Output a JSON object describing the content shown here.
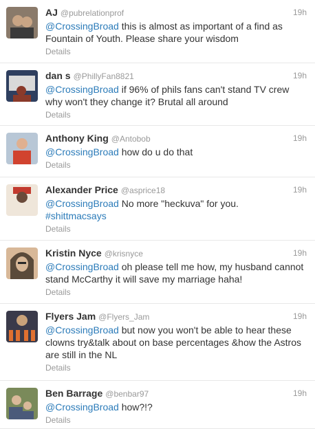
{
  "tweets": [
    {
      "name": "AJ",
      "handle": "@pubrelationprof",
      "time": "19h",
      "mention": "@CrossingBroad",
      "text": " this is almost as important of a find as Fountain of Youth. Please share your wisdom",
      "details": "Details",
      "avatar_colors": [
        "#8a7a6a",
        "#c9a585",
        "#3a3a3a"
      ]
    },
    {
      "name": "dan s",
      "handle": "@PhillyFan8821",
      "time": "19h",
      "mention": "@CrossingBroad",
      "text": " if 96% of phils fans can't stand TV crew why won't they change it?  Brutal all around",
      "details": "Details",
      "avatar_colors": [
        "#2f3f5f",
        "#d9d9d9",
        "#8a3a2a"
      ]
    },
    {
      "name": "Anthony King",
      "handle": "@Antobob",
      "time": "19h",
      "mention": "@CrossingBroad",
      "text": " how do u do that",
      "details": "Details",
      "avatar_colors": [
        "#b8c7d6",
        "#d1432f",
        "#e0b090"
      ]
    },
    {
      "name": "Alexander Price",
      "handle": "@asprice18",
      "time": "19h",
      "mention": "@CrossingBroad",
      "text": " No more \"heckuva\" for you.",
      "hashtag": "#shittmacsays",
      "details": "Details",
      "avatar_colors": [
        "#c23a2e",
        "#efe6da",
        "#6a4a3a"
      ]
    },
    {
      "name": "Kristin Nyce",
      "handle": "@krisnyce",
      "time": "19h",
      "mention": "@CrossingBroad",
      "text": " oh please tell me how, my husband cannot stand McCarthy it will save my marriage haha!",
      "details": "Details",
      "avatar_colors": [
        "#5a4a3a",
        "#d8b898",
        "#2a2a2a"
      ]
    },
    {
      "name": "Flyers Jam",
      "handle": "@Flyers_Jam",
      "time": "19h",
      "mention": "@CrossingBroad",
      "text": " but now you won't be able to hear these clowns try&talk about on base percentages &how the Astros are still in the NL",
      "details": "Details",
      "avatar_colors": [
        "#3a3a4a",
        "#c9a27a",
        "#e07030"
      ]
    },
    {
      "name": "Ben Barrage",
      "handle": "@benbar97",
      "time": "19h",
      "mention": "@CrossingBroad",
      "text": " how?!?",
      "details": "Details",
      "avatar_colors": [
        "#7a8a5a",
        "#d9b99a",
        "#4a5a7a"
      ]
    }
  ]
}
